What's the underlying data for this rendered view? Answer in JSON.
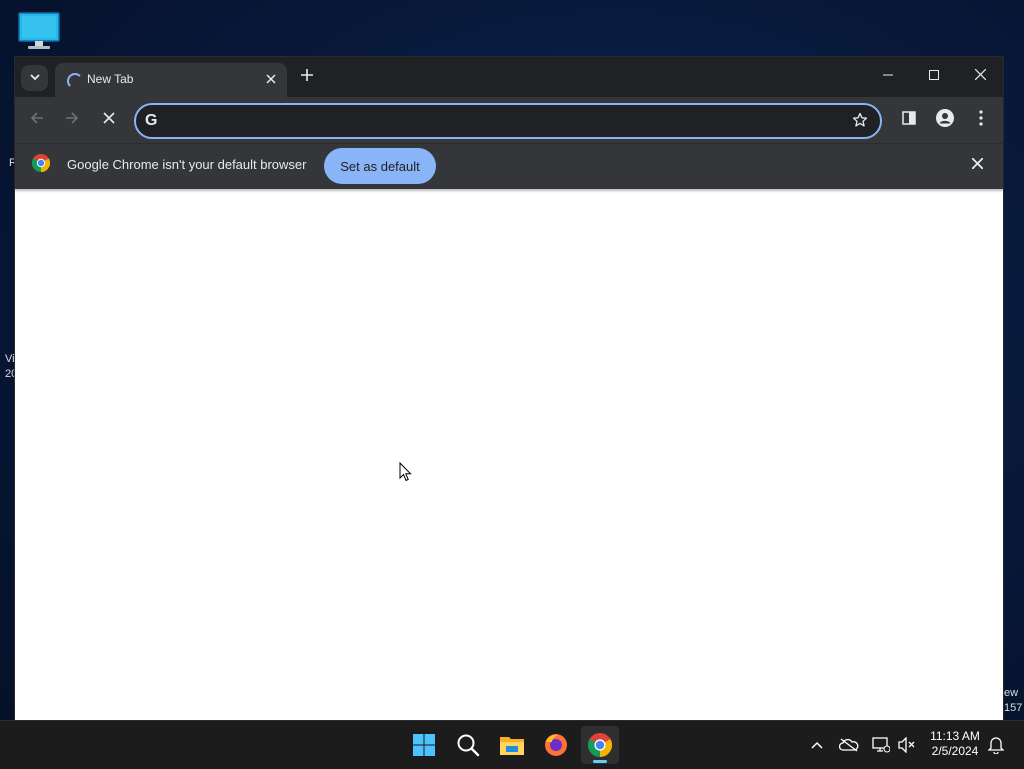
{
  "desktop": {
    "icon": "this-pc-monitor-icon",
    "fragments": {
      "left_top": "R",
      "left_mid_1": "Vi",
      "left_mid_2": "20",
      "right_bottom_1": "ew",
      "right_bottom_2": "157"
    }
  },
  "browser": {
    "tab": {
      "title": "New Tab",
      "loading": true
    },
    "omnibox": {
      "value": "",
      "placeholder": ""
    },
    "infobar": {
      "message": "Google Chrome isn't your default browser",
      "button_label": "Set as default"
    },
    "colors": {
      "frame": "#202124",
      "toolbar": "#35363a",
      "accent": "#8ab4f8",
      "content": "#ffffff"
    }
  },
  "taskbar": {
    "apps": [
      "windows-start-icon",
      "search-icon",
      "file-explorer-icon",
      "firefox-icon",
      "chrome-icon"
    ],
    "active_app": "chrome-icon",
    "clock": {
      "time": "11:13 AM",
      "date": "2/5/2024"
    }
  }
}
